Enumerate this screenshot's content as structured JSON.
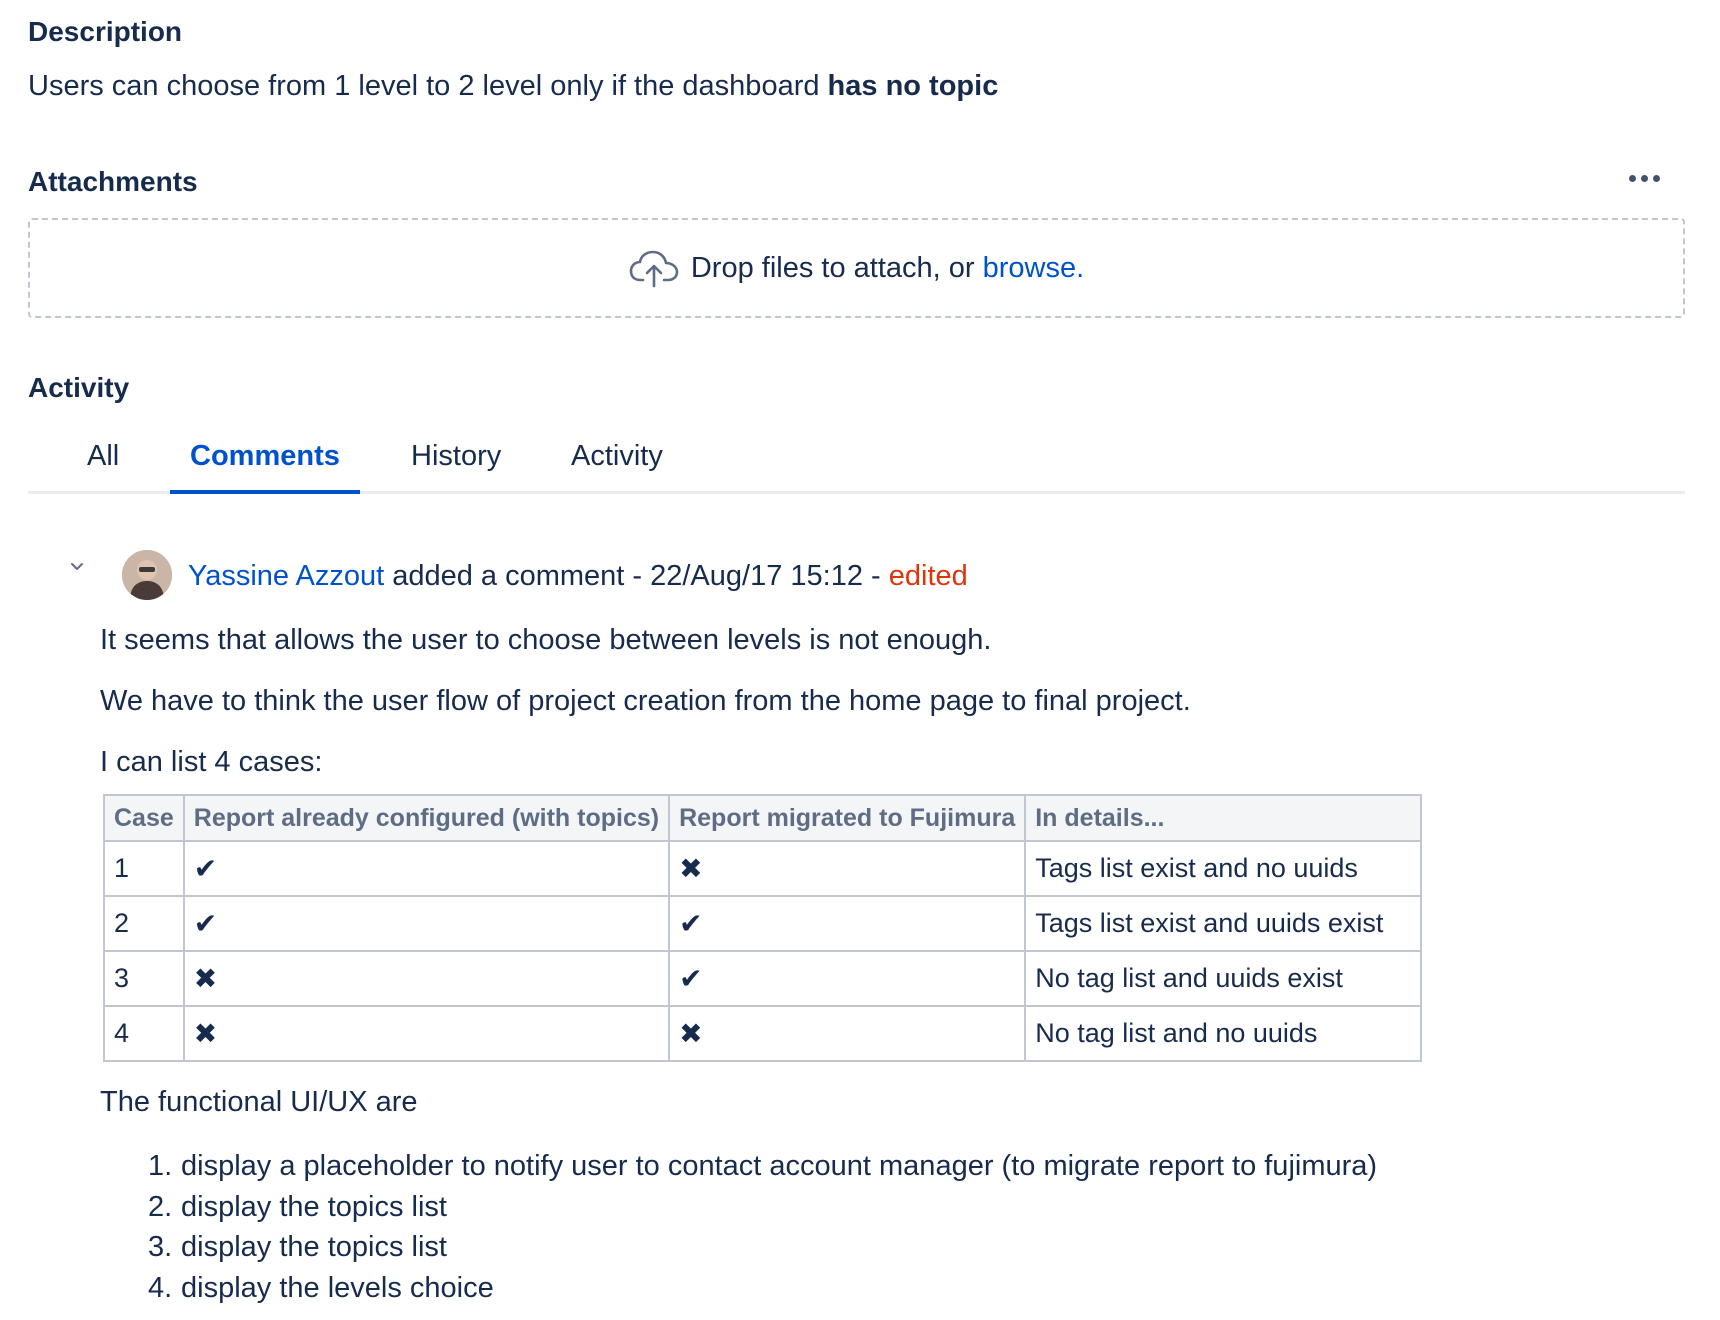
{
  "description": {
    "heading": "Description",
    "text_before": "Users can choose from 1 level to 2 level only if the dashboard ",
    "text_bold": "has no topic"
  },
  "attachments": {
    "heading": "Attachments",
    "drop_text": "Drop files to attach, or ",
    "browse_label": "browse."
  },
  "activity": {
    "heading": "Activity",
    "tabs": [
      {
        "label": "All",
        "active": false
      },
      {
        "label": "Comments",
        "active": true
      },
      {
        "label": "History",
        "active": false
      },
      {
        "label": "Activity",
        "active": false
      }
    ]
  },
  "comment": {
    "author": "Yassine Azzout",
    "action": " added a comment - 22/Aug/17 15:12 - ",
    "edited_label": "edited",
    "paragraphs": [
      "It seems that allows the user to choose between levels is not enough.",
      "We have to think the user flow of project creation from the home page to final project.",
      "I can list 4 cases:",
      "The functional UI/UX are"
    ],
    "table": {
      "headers": [
        "Case",
        "Report already configured (with topics)",
        "Report migrated to Fujimura",
        "In details..."
      ],
      "rows": [
        [
          "1",
          "✔",
          "✖",
          "Tags list exist and no uuids"
        ],
        [
          "2",
          "✔",
          "✔",
          "Tags list exist and uuids exist"
        ],
        [
          "3",
          "✖",
          "✔",
          "No tag list and uuids exist"
        ],
        [
          "4",
          "✖",
          "✖",
          "No tag list and no uuids"
        ]
      ]
    },
    "list": [
      {
        "num": "1.",
        "text": "display a placeholder to notify user to contact account manager (to migrate report to fujimura)"
      },
      {
        "num": "2.",
        "text": "display the topics list"
      },
      {
        "num": "3.",
        "text": "display the topics list"
      },
      {
        "num": "4.",
        "text": "display the levels choice"
      }
    ]
  },
  "icons": {
    "more": "more-horizontal-icon",
    "upload": "cloud-upload-icon",
    "collapse": "chevron-down-icon",
    "avatar": "user-avatar"
  },
  "colors": {
    "link": "#0052cc",
    "edited": "#de350b",
    "text": "#172b4d"
  }
}
